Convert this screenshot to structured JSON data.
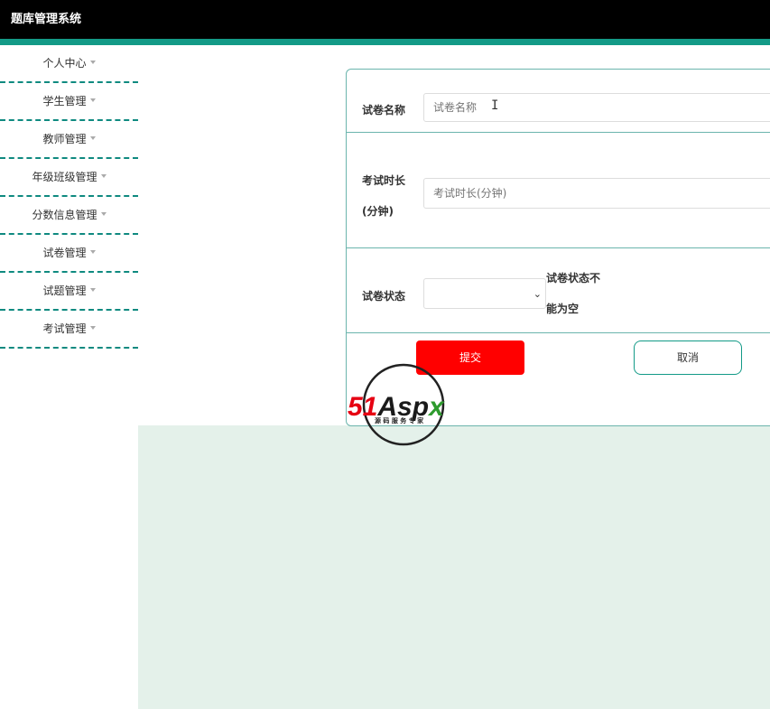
{
  "header": {
    "title": "题库管理系统"
  },
  "sidebar": {
    "items": [
      {
        "label": "个人中心"
      },
      {
        "label": "学生管理"
      },
      {
        "label": "教师管理"
      },
      {
        "label": "年级班级管理"
      },
      {
        "label": "分数信息管理"
      },
      {
        "label": "试卷管理"
      },
      {
        "label": "试题管理"
      },
      {
        "label": "考试管理"
      }
    ]
  },
  "form": {
    "name": {
      "label": "试卷名称",
      "placeholder": "试卷名称",
      "value": ""
    },
    "duration": {
      "label_line1": "考试时长",
      "label_line2": "(分钟)",
      "placeholder": "考试时长(分钟)",
      "value": ""
    },
    "status": {
      "label": "试卷状态",
      "selected": "",
      "error_line1": "试卷状态不",
      "error_line2": "能为空"
    },
    "submit_label": "提交",
    "cancel_label": "取消"
  },
  "watermark": {
    "brand": "51Aspx",
    "tagline": "源码服务专家"
  },
  "colors": {
    "topbar": "#000000",
    "accent": "#139a87",
    "submit": "#ff0000",
    "content_bg": "#e4f1ea"
  }
}
